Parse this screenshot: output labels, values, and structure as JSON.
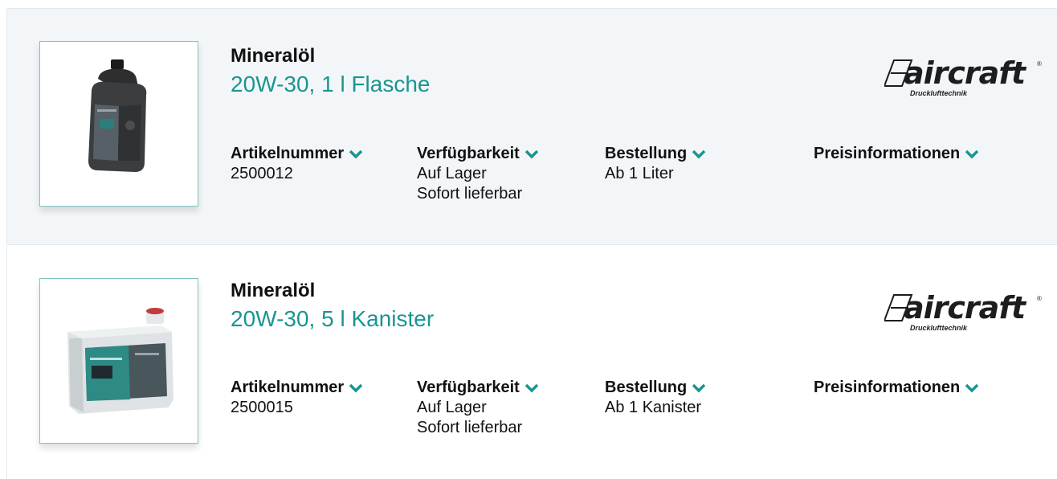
{
  "accent_color": "#1a9590",
  "products": [
    {
      "name": "Mineralöl",
      "variant": "20W-30, 1 l Flasche",
      "image": "oil-bottle-image",
      "brand": {
        "word": "aircraft",
        "registered": "®",
        "tagline": "Drucklufttechnik"
      },
      "details": {
        "artikelnummer_label": "Artikelnummer",
        "artikelnummer_value": "2500012",
        "verfuegbarkeit_label": "Verfügbarkeit",
        "verfuegbarkeit_line1": "Auf Lager",
        "verfuegbarkeit_line2": "Sofort lieferbar",
        "bestellung_label": "Bestellung",
        "bestellung_value": "Ab 1 Liter",
        "preis_label": "Preisinformationen"
      }
    },
    {
      "name": "Mineralöl",
      "variant": "20W-30, 5 l Kanister",
      "image": "oil-canister-image",
      "brand": {
        "word": "aircraft",
        "registered": "®",
        "tagline": "Drucklufttechnik"
      },
      "details": {
        "artikelnummer_label": "Artikelnummer",
        "artikelnummer_value": "2500015",
        "verfuegbarkeit_label": "Verfügbarkeit",
        "verfuegbarkeit_line1": "Auf Lager",
        "verfuegbarkeit_line2": "Sofort lieferbar",
        "bestellung_label": "Bestellung",
        "bestellung_value": "Ab 1 Kanister",
        "preis_label": "Preisinformationen"
      }
    }
  ]
}
